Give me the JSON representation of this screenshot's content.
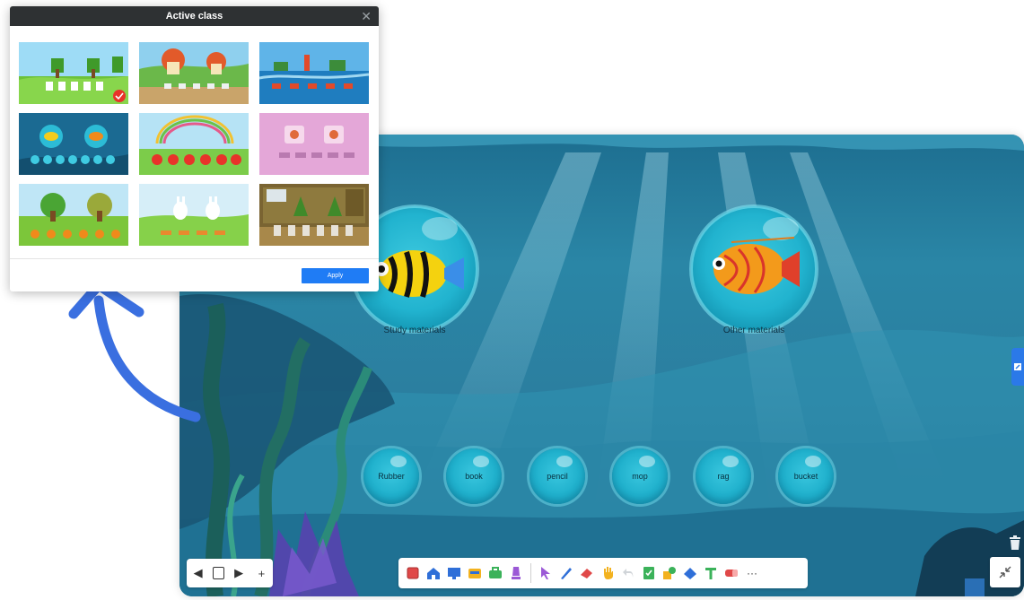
{
  "dialog": {
    "title": "Active class",
    "apply_label": "Apply",
    "templates": [
      {
        "name": "garden-rabbits",
        "selected": true
      },
      {
        "name": "mushroom-houses",
        "selected": false
      },
      {
        "name": "sea-islands",
        "selected": false
      },
      {
        "name": "underwater-fish",
        "selected": false
      },
      {
        "name": "rainbow-apples",
        "selected": false
      },
      {
        "name": "pink-frames",
        "selected": false
      },
      {
        "name": "trees-carrots",
        "selected": false
      },
      {
        "name": "rabbits-meadow",
        "selected": false
      },
      {
        "name": "classroom-plants",
        "selected": false
      }
    ]
  },
  "board": {
    "categories": [
      {
        "label": "Study materials"
      },
      {
        "label": "Other materials"
      }
    ],
    "words": [
      "Rubber",
      "book",
      "pencil",
      "mop",
      "rag",
      "bucket"
    ]
  },
  "toolbar": {
    "items": [
      "square-icon",
      "home-icon",
      "screen-icon",
      "folder-icon",
      "toolbox-icon",
      "highlighter-icon",
      "pointer-icon",
      "pen-icon",
      "eraser-icon",
      "hand-icon",
      "undo-icon",
      "note-icon",
      "shapes-icon",
      "fill-icon",
      "text-icon",
      "eraser-tool-icon",
      "more-icon"
    ],
    "more_label": "···"
  },
  "colors": {
    "accent": "#1f7cf5",
    "arrow": "#3a6fe0",
    "water": "#2a86a6",
    "bubble": "#1fb0cc"
  }
}
